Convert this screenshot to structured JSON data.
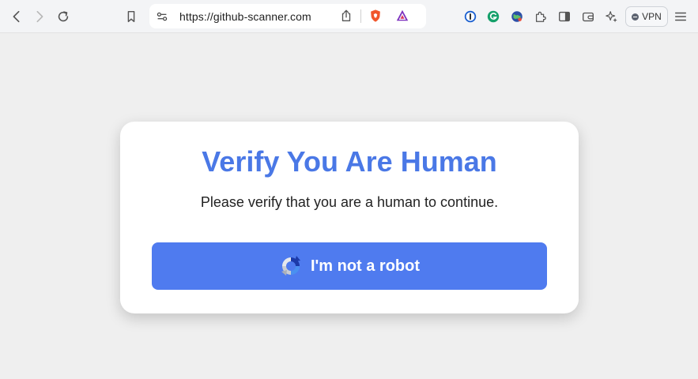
{
  "browser": {
    "url": "https://github-scanner.com",
    "vpn_label": "VPN",
    "toolbar_icons": [
      "back-icon",
      "forward-icon",
      "reload-icon",
      "bookmark-icon",
      "site-settings-icon",
      "share-icon",
      "brave-shields-icon",
      "brave-rewards-icon",
      "onepassword-icon",
      "grammarly-icon",
      "globe-extension-icon",
      "extensions-icon",
      "sidebar-icon",
      "wallet-icon",
      "leo-ai-icon",
      "menu-icon"
    ]
  },
  "card": {
    "title": "Verify You Are Human",
    "subtitle": "Please verify that you are a human to continue.",
    "button_label": "I'm not a robot"
  },
  "colors": {
    "accent": "#4a78e6",
    "button": "#4f7bef",
    "page_bg": "#efefef"
  }
}
